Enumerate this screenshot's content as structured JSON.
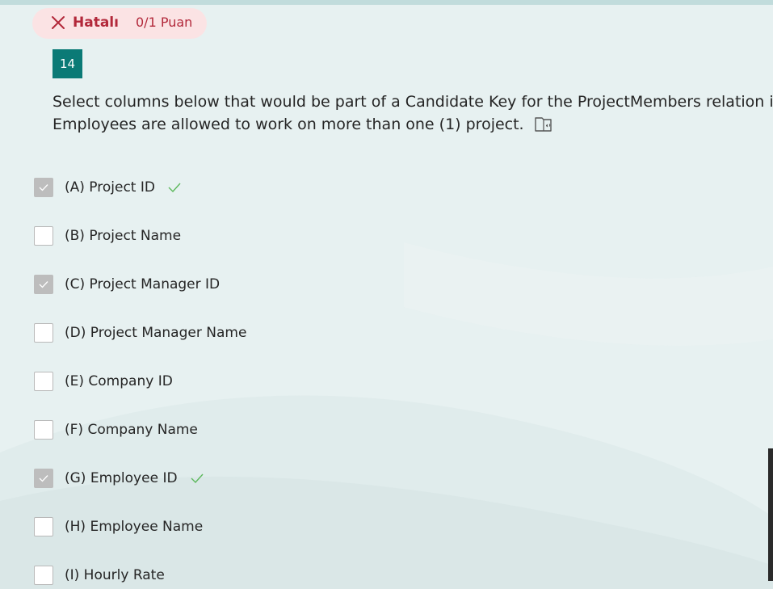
{
  "result": {
    "status_label": "Hatalı",
    "score": "0/1 Puan",
    "color": "#b2283a",
    "icon": "close-icon"
  },
  "question": {
    "number": "14",
    "text_line1": "Select columns below that would be part of a Candidate Key for the ProjectMembers relation if",
    "text_line2": "Employees are allowed to work on more than one (1) project.",
    "reader_icon": "immersive-reader-icon"
  },
  "options": [
    {
      "label": "(A) Project ID",
      "checked": true,
      "correct": true
    },
    {
      "label": "(B) Project Name",
      "checked": false,
      "correct": false
    },
    {
      "label": "(C) Project Manager ID",
      "checked": true,
      "correct": false
    },
    {
      "label": "(D) Project Manager Name",
      "checked": false,
      "correct": false
    },
    {
      "label": "(E) Company ID",
      "checked": false,
      "correct": false
    },
    {
      "label": "(F) Company Name",
      "checked": false,
      "correct": false
    },
    {
      "label": "(G) Employee ID",
      "checked": true,
      "correct": true
    },
    {
      "label": "(H) Employee Name",
      "checked": false,
      "correct": false
    },
    {
      "label": "(I) Hourly Rate",
      "checked": false,
      "correct": false
    }
  ],
  "colors": {
    "accent": "#0b7a76",
    "correct_mark": "#5cb85c",
    "background": "#e6f0f0"
  }
}
